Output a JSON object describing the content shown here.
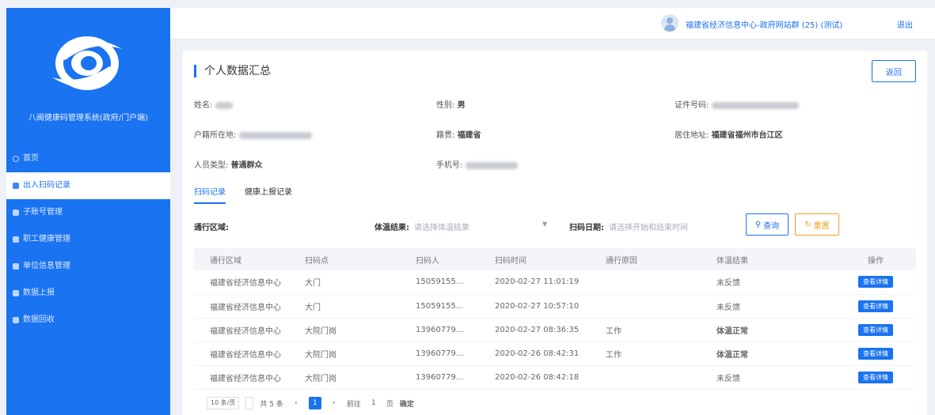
{
  "app": {
    "title": "八闽健康码管理系统(政府/门户端)"
  },
  "sidebar": {
    "items": [
      {
        "label": "首页",
        "active": false,
        "icon": "home-icon"
      },
      {
        "label": "出入扫码记录",
        "active": true,
        "icon": "records-icon"
      },
      {
        "label": "子账号管理",
        "active": false,
        "icon": "account-icon"
      },
      {
        "label": "职工健康管理",
        "active": false,
        "icon": "health-icon"
      },
      {
        "label": "单位信息管理",
        "active": false,
        "icon": "org-icon"
      },
      {
        "label": "数据上报",
        "active": false,
        "icon": "report-icon"
      },
      {
        "label": "数据回收",
        "active": false,
        "icon": "recycle-icon"
      }
    ]
  },
  "header": {
    "user_text": "福建省经济信息中心-政府网站群 (25) (测试)",
    "logout": "退出"
  },
  "panel": {
    "title": "个人数据汇总",
    "back_label": "返回",
    "info": {
      "name_label": "姓名:",
      "gender_label": "性别:",
      "gender_value": "男",
      "id_label": "证件号码:",
      "domicile_label": "户籍所在地:",
      "native_label": "籍贯:",
      "native_value": "福建省",
      "address_label": "居住地址:",
      "address_value": "福建省福州市台江区",
      "type_label": "人员类型:",
      "type_value": "普通群众",
      "phone_label": "手机号:"
    },
    "tabs": [
      "扫码记录",
      "健康上报记录"
    ],
    "filters": {
      "area_label": "通行区域:",
      "temp_label": "体温结果:",
      "temp_placeholder": "请选择体温结果",
      "date_label": "扫码日期:",
      "date_placeholder": "请选择开始和结束时间",
      "query_label": "查询",
      "reset_label": "重置"
    },
    "table": {
      "headers": [
        "通行区域",
        "扫码点",
        "扫码人",
        "扫码时间",
        "通行原因",
        "体温结果",
        "操作"
      ],
      "rows": [
        [
          "福建省经济信息中心",
          "大门",
          "15059155...",
          "2020-02-27 11:01:19",
          "",
          "未反馈",
          "查看详情"
        ],
        [
          "福建省经济信息中心",
          "大门",
          "15059155...",
          "2020-02-27 10:57:10",
          "",
          "未反馈",
          "查看详情"
        ],
        [
          "福建省经济信息中心",
          "大院门岗",
          "13960779...",
          "2020-02-27 08:36:35",
          "工作",
          "体温正常",
          "查看详情"
        ],
        [
          "福建省经济信息中心",
          "大院门岗",
          "13960779...",
          "2020-02-26 08:42:31",
          "工作",
          "体温正常",
          "查看详情"
        ],
        [
          "福建省经济信息中心",
          "大院门岗",
          "13960779...",
          "2020-02-26 08:42:18",
          "",
          "未反馈",
          "查看详情"
        ]
      ]
    },
    "pager": {
      "size_label": "10 条/页",
      "total_label": "共 5 条",
      "current_page": "1",
      "goto_label": "前往",
      "goto_value": "1",
      "page_unit": "页",
      "confirm_label": "确定"
    }
  },
  "colors": {
    "primary": "#1a73f0",
    "warn": "#f0a020",
    "temp_ok": "#6a2fd6"
  }
}
